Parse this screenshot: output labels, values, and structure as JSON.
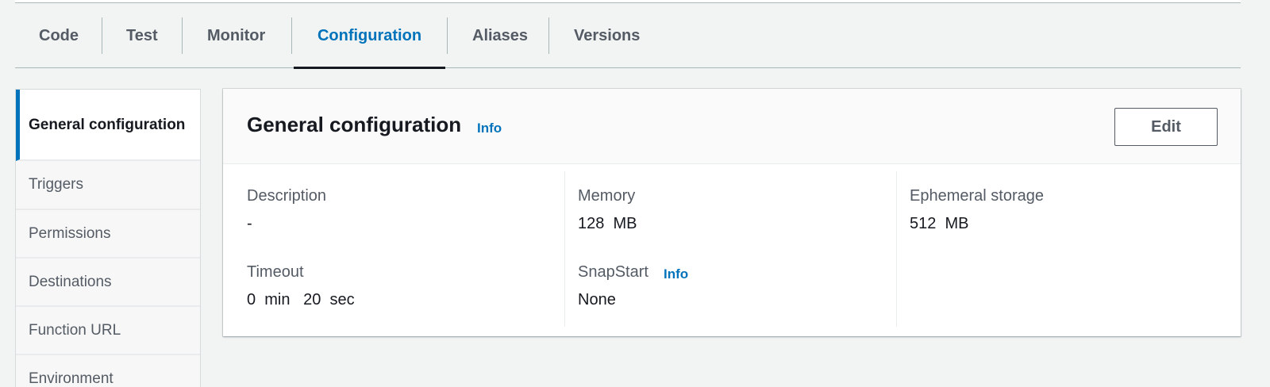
{
  "tabs": [
    {
      "label": "Code"
    },
    {
      "label": "Test"
    },
    {
      "label": "Monitor"
    },
    {
      "label": "Configuration",
      "active": true
    },
    {
      "label": "Aliases"
    },
    {
      "label": "Versions"
    }
  ],
  "sidebar": {
    "items": [
      {
        "label": "General configuration",
        "active": true
      },
      {
        "label": "Triggers"
      },
      {
        "label": "Permissions"
      },
      {
        "label": "Destinations"
      },
      {
        "label": "Function URL"
      },
      {
        "label": "Environment"
      }
    ]
  },
  "panel": {
    "title": "General configuration",
    "info_label": "Info",
    "edit_label": "Edit",
    "fields": {
      "description": {
        "label": "Description",
        "value": "-"
      },
      "timeout": {
        "label": "Timeout",
        "value": "0  min   20  sec"
      },
      "memory": {
        "label": "Memory",
        "value": "128  MB"
      },
      "snapstart": {
        "label": "SnapStart",
        "info_label": "Info",
        "value": "None"
      },
      "ephemeral_storage": {
        "label": "Ephemeral storage",
        "value": "512  MB"
      }
    }
  },
  "colors": {
    "accent": "#0073bb",
    "background": "#f2f3f3",
    "text": "#16191f",
    "muted": "#545b64"
  }
}
